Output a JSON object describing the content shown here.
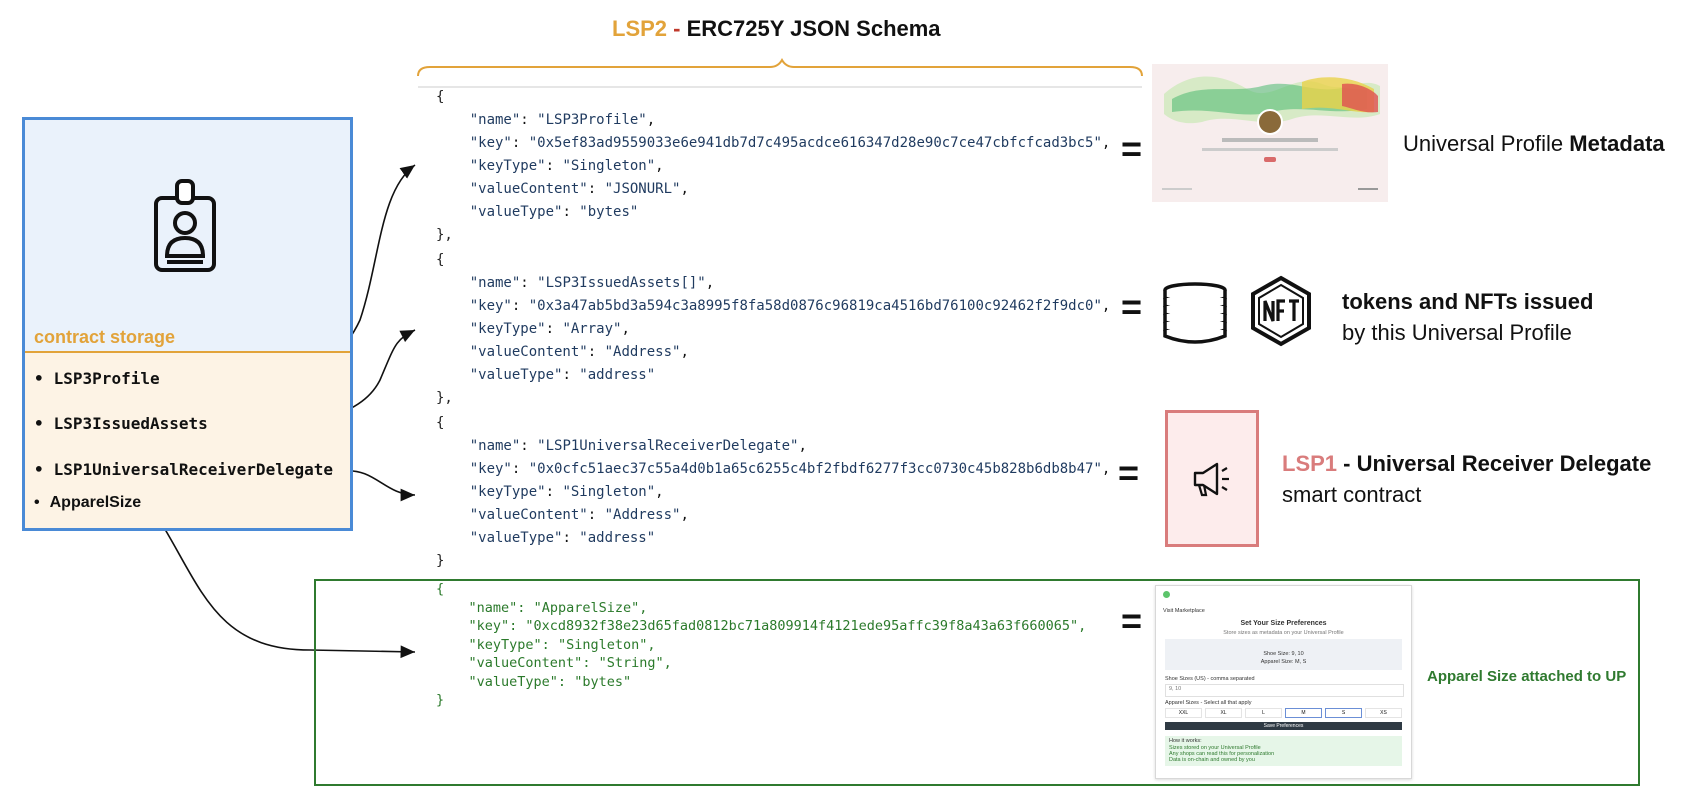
{
  "header": {
    "lsp2": "LSP2",
    "dash": " - ",
    "schema": "ERC725Y JSON Schema"
  },
  "storage": {
    "label": "contract storage",
    "items": [
      {
        "bullet": "•",
        "text": "LSP3Profile"
      },
      {
        "bullet": "•",
        "text": "LSP3IssuedAssets"
      },
      {
        "bullet": "•",
        "text": "LSP1UniversalReceiverDelegate"
      },
      {
        "bullet": "•",
        "text": "ApparelSize"
      }
    ],
    "icon": "id-badge-icon"
  },
  "schemas": [
    {
      "open": "{",
      "name_key": "\"name\"",
      "name_val": "\"LSP3Profile\"",
      "key_key": "\"key\"",
      "key_val": "\"0x5ef83ad9559033e6e941db7d7c495acdce616347d28e90c7ce47cbfcfcad3bc5\"",
      "keyType_key": "\"keyType\"",
      "keyType_val": "\"Singleton\"",
      "valueContent_key": "\"valueContent\"",
      "valueContent_val": "\"JSONURL\"",
      "valueType_key": "\"valueType\"",
      "valueType_val": "\"bytes\"",
      "close": "},"
    },
    {
      "open": "{",
      "name_key": "\"name\"",
      "name_val": "\"LSP3IssuedAssets[]\"",
      "key_key": "\"key\"",
      "key_val": "\"0x3a47ab5bd3a594c3a8995f8fa58d0876c96819ca4516bd76100c92462f2f9dc0\"",
      "keyType_key": "\"keyType\"",
      "keyType_val": "\"Array\"",
      "valueContent_key": "\"valueContent\"",
      "valueContent_val": "\"Address\"",
      "valueType_key": "\"valueType\"",
      "valueType_val": "\"address\"",
      "close": "},"
    },
    {
      "open": "{",
      "name_key": "\"name\"",
      "name_val": "\"LSP1UniversalReceiverDelegate\"",
      "key_key": "\"key\"",
      "key_val": "\"0x0cfc51aec37c55a4d0b1a65c6255c4bf2fbdf6277f3cc0730c45b828b6db8b47\"",
      "keyType_key": "\"keyType\"",
      "keyType_val": "\"Singleton\"",
      "valueContent_key": "\"valueContent\"",
      "valueContent_val": "\"Address\"",
      "valueType_key": "\"valueType\"",
      "valueType_val": "\"address\"",
      "close": "}"
    },
    {
      "open": "{",
      "name_key": "\"name\"",
      "name_val": "\"ApparelSize\"",
      "key_key": "\"key\"",
      "key_val": "\"0xcd8932f38e23d65fad0812bc71a809914f4121ede95affc39f8a43a63f660065\"",
      "keyType_key": "\"keyType\"",
      "keyType_val": "\"Singleton\"",
      "valueContent_key": "\"valueContent\"",
      "valueContent_val": "\"String\"",
      "valueType_key": "\"valueType\"",
      "valueType_val": "\"bytes\"",
      "close": "}"
    }
  ],
  "equals": "=",
  "labels": {
    "up_prefix": "Universal Profile ",
    "up_bold": "Metadata",
    "tokens_line1": "tokens and NFTs issued",
    "tokens_line2": "by this Universal Profile",
    "lsp1_prefix": "LSP1",
    "lsp1_rest": " - Universal Receiver Delegate",
    "lsp1_line2": "smart contract",
    "apparel_caption": "Apparel Size attached to UP"
  },
  "icons": {
    "coins": "coin-stack-icon",
    "nft": "nft-hexagon-icon",
    "megaphone": "megaphone-icon"
  },
  "app_thumb": {
    "nav": "Visit Marketplace",
    "title": "Set Your Size Preferences",
    "subtitle": "Store sizes as metadata on your Universal Profile",
    "shoe_size": "Shoe Size: 9, 10",
    "apparel_size": "Apparel Size: M, S",
    "shoe_label": "Shoe Sizes (US) - comma separated",
    "shoe_value": "9, 10",
    "apparel_label": "Apparel Sizes - Select all that apply",
    "sizes": [
      "XXL",
      "XL",
      "L",
      "M",
      "S",
      "XS"
    ],
    "save": "Save Preferences",
    "how_title": "How it works:",
    "how_items": [
      "Sizes stored on your Universal Profile",
      "Any shops can read this for personalization",
      "Data is on-chain and owned by you"
    ]
  },
  "colors": {
    "lsp2": "#e2a33a",
    "storage_border": "#4a8ad6",
    "lsp1_red": "#d97c7c",
    "green": "#2f7a2f"
  }
}
